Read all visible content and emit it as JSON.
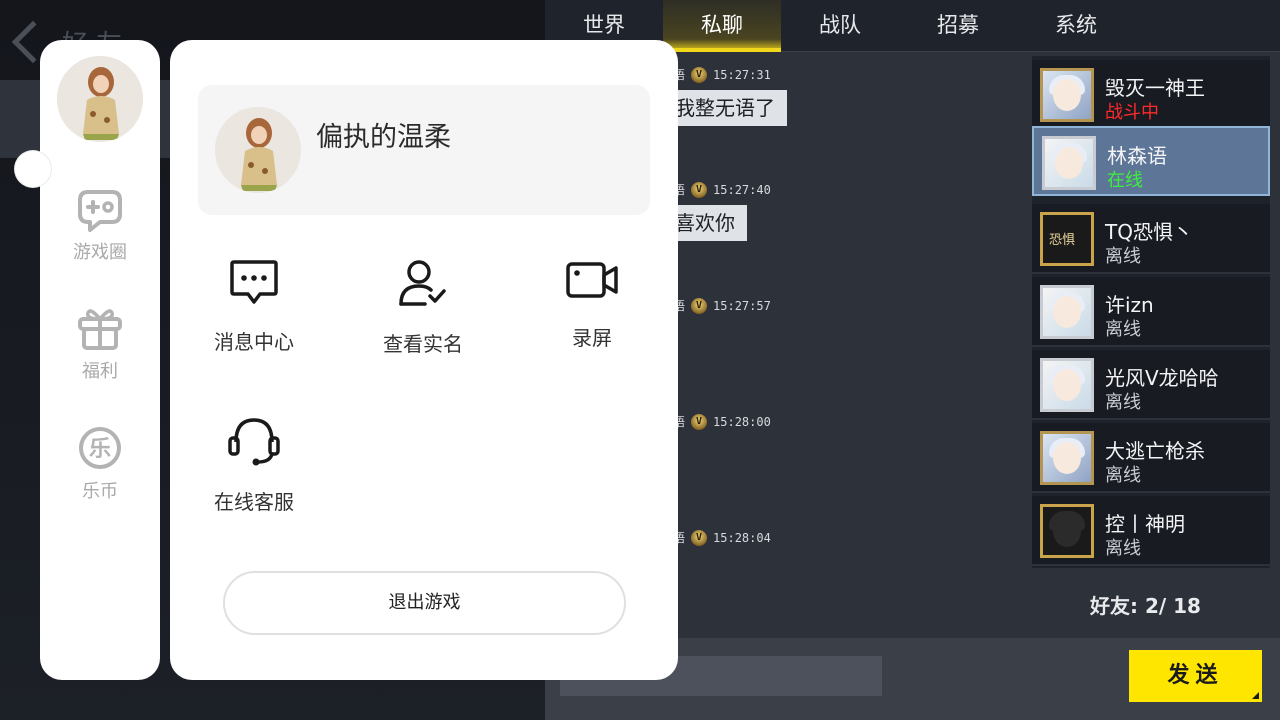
{
  "background": {
    "page_title": "好友"
  },
  "chat": {
    "tabs": [
      {
        "label": "世界"
      },
      {
        "label": "私聊"
      },
      {
        "label": "战队"
      },
      {
        "label": "招募"
      },
      {
        "label": "系统"
      }
    ],
    "active_tab": "私聊",
    "messages": [
      {
        "sender_fragment": "语",
        "time": "15:27:31",
        "text": "我整无语了"
      },
      {
        "sender_fragment": "语",
        "time": "15:27:40",
        "text": "喜欢你"
      },
      {
        "sender_fragment": "语",
        "time": "15:27:57",
        "text": ""
      },
      {
        "sender_fragment": "语",
        "time": "15:28:00",
        "text": ""
      },
      {
        "sender_fragment": "语",
        "time": "15:28:04",
        "text": ""
      }
    ],
    "badge_glyph": "V",
    "friends": [
      {
        "name": "毁灭一神王",
        "status": "战斗中",
        "state": "fighting"
      },
      {
        "name": "林森语",
        "status": "在线",
        "state": "online",
        "selected": true
      },
      {
        "name": "TQ恐惧丶",
        "status": "离线",
        "state": "offline",
        "avatar_text": "恐惧"
      },
      {
        "name": "许izn",
        "status": "离线",
        "state": "offline"
      },
      {
        "name": "光风V龙哈哈",
        "status": "离线",
        "state": "offline"
      },
      {
        "name": "大逃亡枪杀",
        "status": "离线",
        "state": "offline"
      },
      {
        "name": "控丨神明",
        "status": "离线",
        "state": "offline"
      }
    ],
    "friend_count": "好友: 2/ 18",
    "send_label": "发送"
  },
  "sidebar": {
    "nav": [
      {
        "label": "游戏圈",
        "icon": "gamepad-icon"
      },
      {
        "label": "福利",
        "icon": "gift-icon"
      },
      {
        "label": "乐币",
        "icon": "coin-icon",
        "glyph": "乐"
      }
    ]
  },
  "menu": {
    "username": "偏执的温柔",
    "items": [
      {
        "label": "消息中心",
        "icon": "message-icon"
      },
      {
        "label": "查看实名",
        "icon": "user-verify-icon"
      },
      {
        "label": "录屏",
        "icon": "video-camera-icon"
      },
      {
        "label": "在线客服",
        "icon": "headset-icon"
      }
    ],
    "logout_label": "退出游戏"
  },
  "colors": {
    "accent_yellow": "#ffe600",
    "status_fighting": "#ff2a2a",
    "status_online": "#3df03d",
    "selected_row": "#5d7597"
  }
}
